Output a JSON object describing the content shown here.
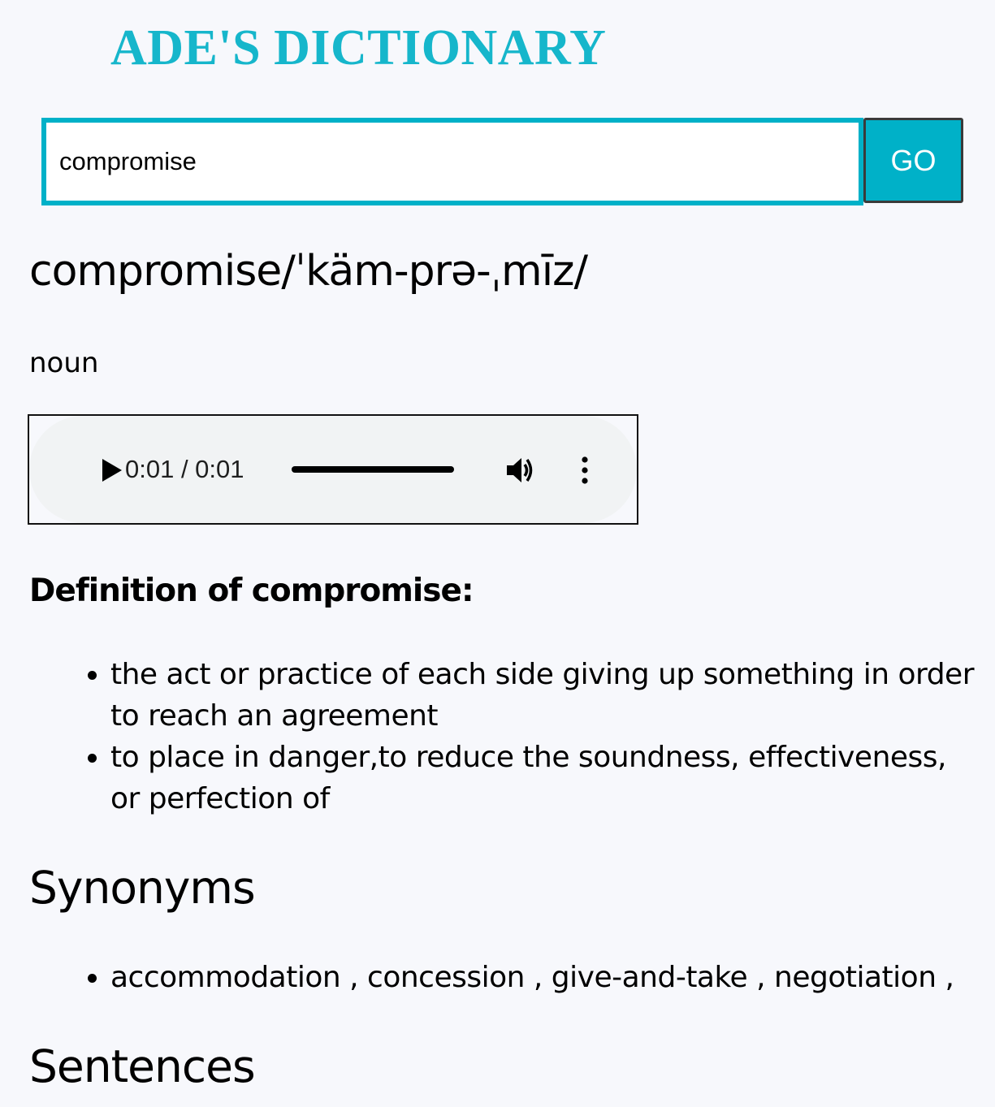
{
  "app": {
    "title": "ADE'S DICTIONARY"
  },
  "search": {
    "value": "compromise",
    "go_label": "GO"
  },
  "entry": {
    "word": "compromise",
    "pronunciation": "/ˈkäm-prə-ˌmīz/",
    "part_of_speech": "noun"
  },
  "audio": {
    "time": "0:01 / 0:01",
    "progress": 1.0
  },
  "definitions": {
    "heading": "Definition of compromise:",
    "items": [
      "the act or practice of each side giving up something in order to reach an agreement",
      "to place in danger,to reduce the soundness, effectiveness, or perfection of"
    ]
  },
  "synonyms": {
    "heading": "Synonyms",
    "text": "accommodation , concession , give-and-take , negotiation ,"
  },
  "sentences": {
    "heading": "Sentences"
  },
  "colors": {
    "accent": "#00b1c8",
    "background": "#f7f8fc"
  }
}
